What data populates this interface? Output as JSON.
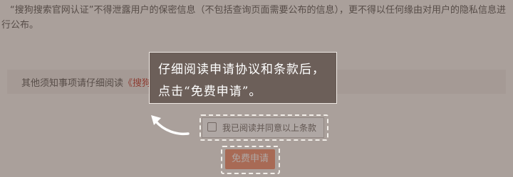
{
  "terms": {
    "line1": "“搜狗搜索官网认证”不得泄露用户的保密信息（不包括查询页面需要公布的信息），更不得以任何缘由对用户的隐私信息进",
    "line2": "行公布。"
  },
  "notice": {
    "prefix": "其他须知事项请仔细阅读",
    "link": "《搜狗搜索官网认证服务协议》"
  },
  "agreement": {
    "label": "我已阅读并同意以上条款",
    "checked": false
  },
  "apply_button": {
    "label": "免费申请"
  },
  "guide_tooltip": {
    "line1": "仔细阅读申请协议和条款后，",
    "line2": "点击“免费申请”。"
  },
  "colors": {
    "button": "#f28d6b",
    "link": "#c0392b",
    "tooltip_bg": "#6c5f59"
  }
}
